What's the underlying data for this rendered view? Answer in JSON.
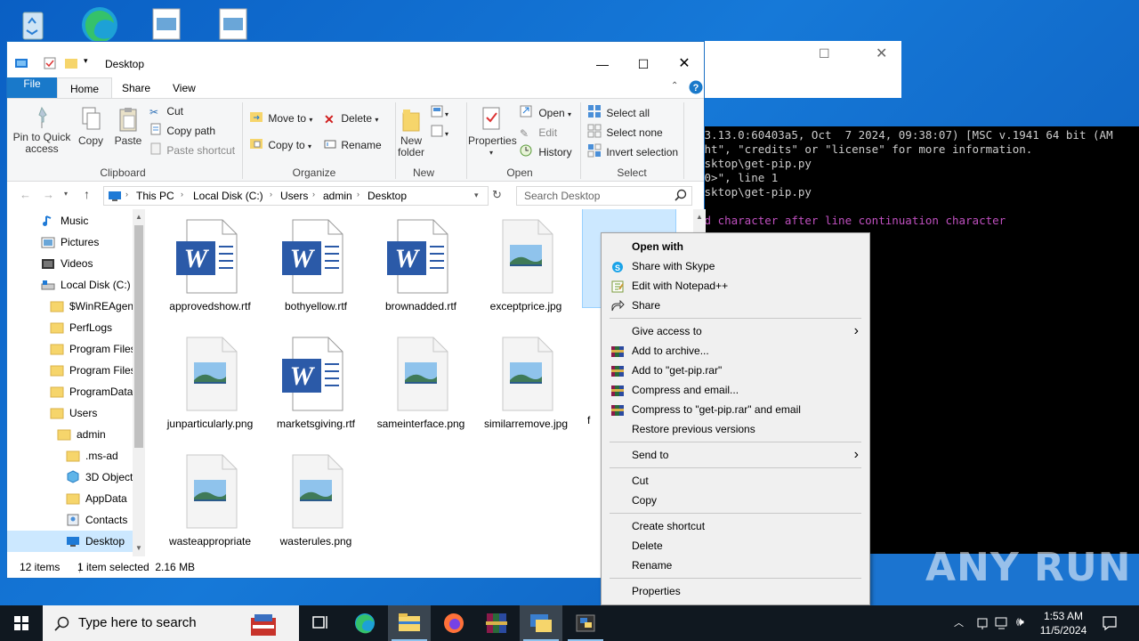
{
  "console": {
    "lines": [
      {
        "text": "v3.13.0:60403a5, Oct  7 2024, 09:38:07) [MSC v.1941 64 bit (AM",
        "magenta": false
      },
      {
        "text": "ght\", \"credits\" or \"license\" for more information.",
        "magenta": false
      },
      {
        "text": "esktop\\get-pip.py",
        "magenta": false
      },
      {
        "text": "-0>\", line 1",
        "magenta": false
      },
      {
        "text": "esktop\\get-pip.py",
        "magenta": false
      },
      {
        "text": "",
        "magenta": false
      },
      {
        "text": "ed character after line continuation character",
        "magenta": true
      }
    ]
  },
  "watermark": "ANY RUN",
  "explorer": {
    "title": "Desktop",
    "tabs": [
      "File",
      "Home",
      "Share",
      "View"
    ],
    "ribbon": {
      "clipboard": {
        "label": "Clipboard",
        "pin": "Pin to Quick access",
        "copy": "Copy",
        "paste": "Paste",
        "cut": "Cut",
        "copy_path": "Copy path",
        "paste_shortcut": "Paste shortcut"
      },
      "organize": {
        "label": "Organize",
        "move_to": "Move to",
        "copy_to": "Copy to",
        "delete": "Delete",
        "rename": "Rename"
      },
      "new": {
        "label": "New",
        "new_folder": "New folder"
      },
      "open": {
        "label": "Open",
        "properties": "Properties",
        "open": "Open",
        "edit": "Edit",
        "history": "History"
      },
      "select": {
        "label": "Select",
        "select_all": "Select all",
        "select_none": "Select none",
        "invert": "Invert selection"
      }
    },
    "address": {
      "crumbs": [
        "This PC",
        "Local Disk (C:)",
        "Users",
        "admin",
        "Desktop"
      ],
      "search_placeholder": "Search Desktop"
    },
    "nav": [
      {
        "label": "Music",
        "icon": "music-icon",
        "indent": 0
      },
      {
        "label": "Pictures",
        "icon": "pictures-icon",
        "indent": 0
      },
      {
        "label": "Videos",
        "icon": "videos-icon",
        "indent": 0
      },
      {
        "label": "Local Disk (C:)",
        "icon": "drive-icon",
        "indent": 0
      },
      {
        "label": "$WinREAgent",
        "icon": "folder-icon",
        "indent": 1
      },
      {
        "label": "PerfLogs",
        "icon": "folder-icon",
        "indent": 1
      },
      {
        "label": "Program Files",
        "icon": "folder-icon",
        "indent": 1
      },
      {
        "label": "Program Files",
        "icon": "folder-icon",
        "indent": 1
      },
      {
        "label": "ProgramData",
        "icon": "folder-icon",
        "indent": 1
      },
      {
        "label": "Users",
        "icon": "folder-icon",
        "indent": 1
      },
      {
        "label": "admin",
        "icon": "folder-icon",
        "indent": 2
      },
      {
        "label": ".ms-ad",
        "icon": "folder-icon",
        "indent": 3
      },
      {
        "label": "3D Objects",
        "icon": "3d-objects-icon",
        "indent": 3
      },
      {
        "label": "AppData",
        "icon": "folder-icon",
        "indent": 3
      },
      {
        "label": "Contacts",
        "icon": "contacts-icon",
        "indent": 3
      },
      {
        "label": "Desktop",
        "icon": "desktop-icon",
        "indent": 3
      }
    ],
    "files": [
      {
        "name": "approvedshow.rtf",
        "type": "word"
      },
      {
        "name": "bothyellow.rtf",
        "type": "word"
      },
      {
        "name": "brownadded.rtf",
        "type": "word"
      },
      {
        "name": "exceptprice.jpg",
        "type": "image"
      },
      {
        "name": "",
        "type": "selected"
      },
      {
        "name": "junparticularly.png",
        "type": "image"
      },
      {
        "name": "marketsgiving.rtf",
        "type": "word"
      },
      {
        "name": "sameinterface.png",
        "type": "image"
      },
      {
        "name": "similarremove.jpg",
        "type": "image"
      },
      {
        "name": "f",
        "type": "partial"
      },
      {
        "name": "wasteappropriate",
        "type": "image"
      },
      {
        "name": "wasterules.png",
        "type": "image"
      }
    ],
    "status": {
      "count": "12 items",
      "selected": "1 item selected  2.16 MB"
    }
  },
  "context_menu": [
    {
      "label": "Open with",
      "bold": true,
      "icon": ""
    },
    {
      "label": "Share with Skype",
      "icon": "skype-icon"
    },
    {
      "label": "Edit with Notepad++",
      "icon": "notepad-plus-plus-icon"
    },
    {
      "label": "Share",
      "icon": "share-icon"
    },
    {
      "sep": true
    },
    {
      "label": "Give access to",
      "submenu": true,
      "icon": ""
    },
    {
      "label": "Add to archive...",
      "icon": "winrar-icon"
    },
    {
      "label": "Add to \"get-pip.rar\"",
      "icon": "winrar-icon"
    },
    {
      "label": "Compress and email...",
      "icon": "winrar-icon"
    },
    {
      "label": "Compress to \"get-pip.rar\" and email",
      "icon": "winrar-icon"
    },
    {
      "label": "Restore previous versions",
      "icon": ""
    },
    {
      "sep": true
    },
    {
      "label": "Send to",
      "submenu": true,
      "icon": ""
    },
    {
      "sep": true
    },
    {
      "label": "Cut",
      "icon": ""
    },
    {
      "label": "Copy",
      "icon": ""
    },
    {
      "sep": true
    },
    {
      "label": "Create shortcut",
      "icon": ""
    },
    {
      "label": "Delete",
      "icon": ""
    },
    {
      "label": "Rename",
      "icon": ""
    },
    {
      "sep": true
    },
    {
      "label": "Properties",
      "icon": ""
    }
  ],
  "taskbar": {
    "search_placeholder": "Type here to search",
    "time": "1:53 AM",
    "date": "11/5/2024"
  },
  "colors": {
    "accent": "#1979ca",
    "selection": "#cce8ff",
    "desktop": "#0b63c5"
  }
}
